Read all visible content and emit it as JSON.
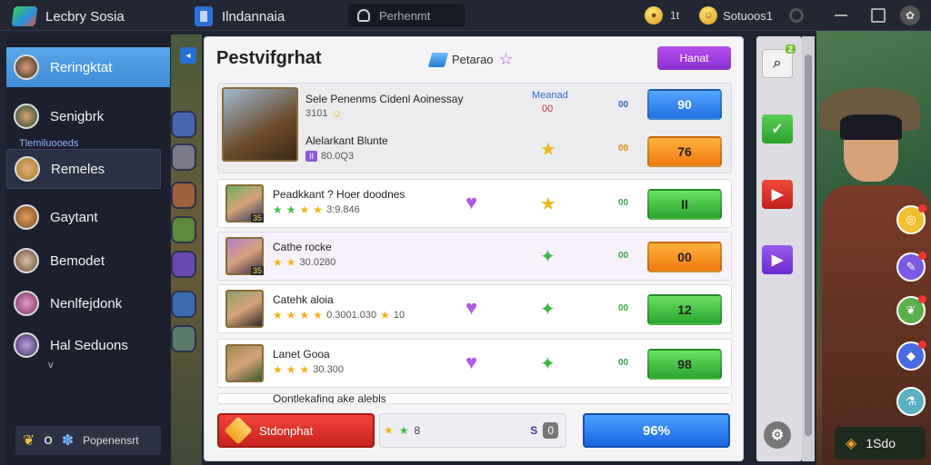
{
  "topbar": {
    "app1_title": "Lecbry Sosia",
    "app2_title": "Ilndannaia",
    "search_placeholder": "Perhenmt",
    "coin_count": "1t",
    "currency_amount": "Sotuoos1",
    "coin_icon": "coin-icon",
    "accent": "#2c6fd6"
  },
  "sidebar": {
    "items": [
      {
        "label": "Reringktat"
      },
      {
        "label": "Senigbrk"
      },
      {
        "label": "Remeles"
      },
      {
        "label": "Gaytant"
      },
      {
        "label": "Bemodet"
      },
      {
        "label": "Nenlfejdonk"
      },
      {
        "label": "Hal Seduons"
      }
    ],
    "sub_label": "Tlemiluooeds",
    "chevron": "v",
    "bottom_label": "Popenensrt",
    "bottom_zero": "O"
  },
  "panel": {
    "title": "Pestvifgrhat",
    "center_label": "Petarao",
    "top_button": "Hanat",
    "rows": [
      {
        "name": "Sele Penenms Cidenl Aoinessay",
        "sub_value": "3101",
        "tag": "Meanad",
        "tag_value": "00",
        "mini": "00",
        "action": "90"
      },
      {
        "name": "Alelarkant Blunte",
        "sub_value": "80.0Q3",
        "badge": "II",
        "mini": "00",
        "action": "76"
      },
      {
        "name": "Peadkkant ? Hoer doodnes",
        "sub_value": "3:9.846",
        "portrait_tag": "35",
        "mini": "00",
        "action": "II"
      },
      {
        "name": "Cathe rocke",
        "sub_value": "30.0280",
        "portrait_tag": "35",
        "mini": "00",
        "action": "00"
      },
      {
        "name": "Catehk aloia",
        "sub_value": "0.3001.030",
        "extra_value": "10",
        "mini": "00",
        "action": "12"
      },
      {
        "name": "Lanet Gooa",
        "sub_value": "30.300",
        "mini": "00",
        "action": "98"
      },
      {
        "name": "Oontlekafing ake alebls",
        "sub_value": "",
        "mini": "",
        "action": ""
      }
    ],
    "footer_left_label": "Stdonphat",
    "footer_mid_value": "8",
    "footer_mid_s": "S",
    "footer_mid_zero": "0",
    "footer_right_label": "96%"
  },
  "tools": {
    "search_badge": "2"
  },
  "art": {
    "button_label": "1Sdo"
  }
}
